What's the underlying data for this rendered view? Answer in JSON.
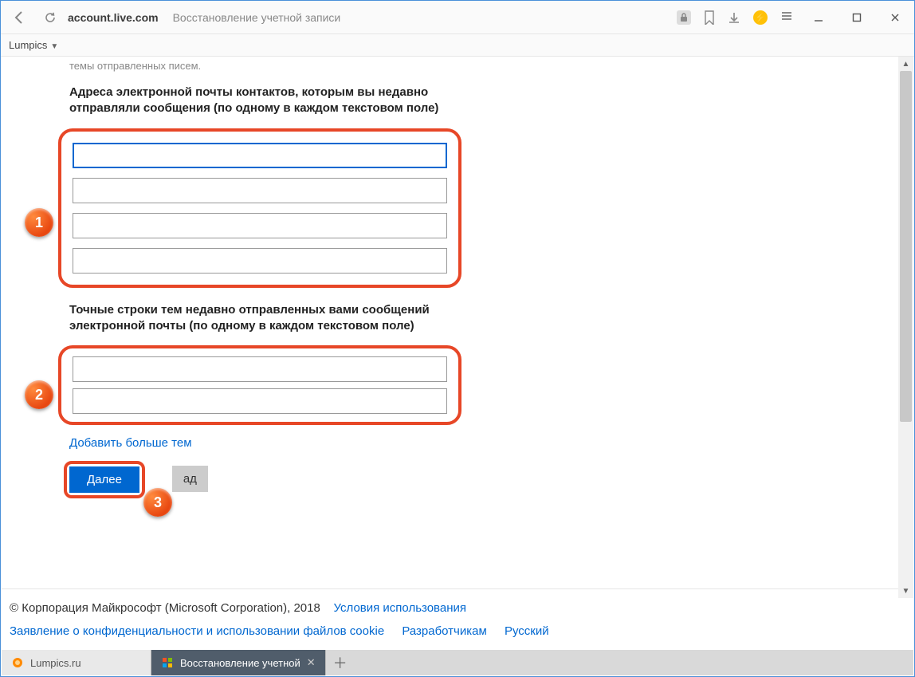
{
  "browser": {
    "host": "account.live.com",
    "page_title": "Восстановление учетной записи",
    "bookmark_label": "Lumpics"
  },
  "cutoff_text": "темы отправленных писем.",
  "section1_label": "Адреса электронной почты контактов, которым вы недавно отправляли сообщения (по одному в каждом текстовом поле)",
  "section2_label": "Точные строки тем недавно отправленных вами сообщений электронной почты (по одному в каждом текстовом поле)",
  "add_more_link": "Добавить больше тем",
  "next_button": "Далее",
  "back_button_fragment": "ад",
  "footer": {
    "copyright": "© Корпорация Майкрософт (Microsoft Corporation), 2018",
    "terms": "Условия использования",
    "privacy": "Заявление о конфиденциальности и использовании файлов cookie",
    "devs": "Разработчикам",
    "lang": "Русский"
  },
  "tabs": {
    "inactive": "Lumpics.ru",
    "active": "Восстановление учетной"
  },
  "callouts": {
    "c1": "1",
    "c2": "2",
    "c3": "3"
  }
}
